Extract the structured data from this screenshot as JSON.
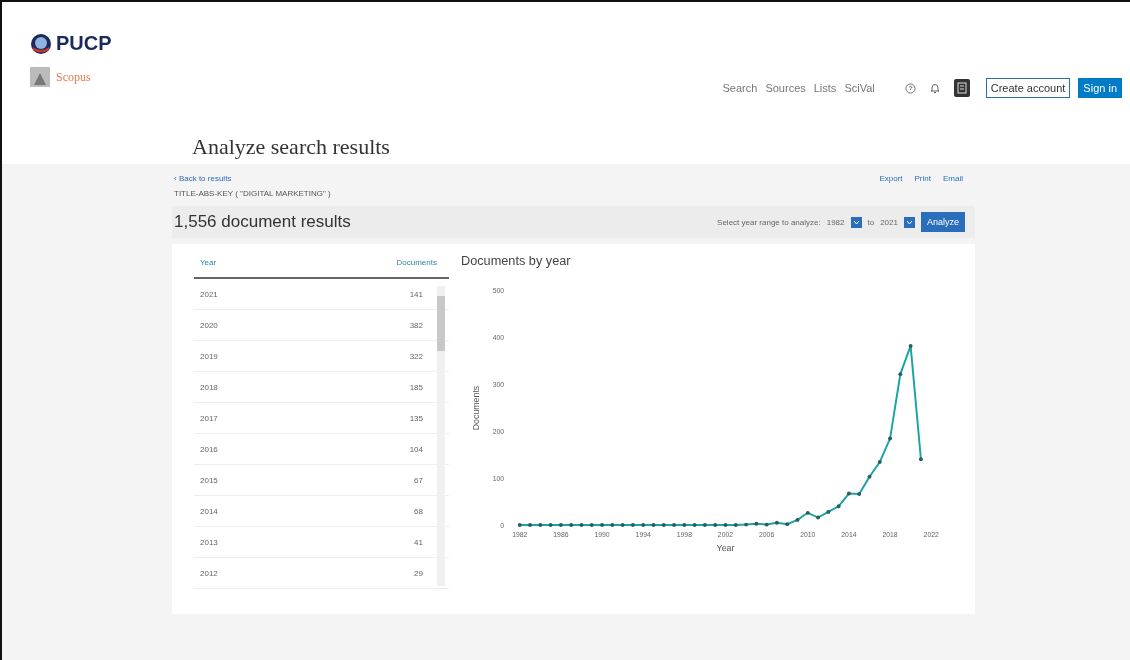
{
  "header": {
    "institution": "PUCP",
    "product": "Scopus",
    "nav": [
      "Search",
      "Sources",
      "Lists",
      "SciVal"
    ],
    "create_account": "Create account",
    "sign_in": "Sign in"
  },
  "page_title": "Analyze search results",
  "back_link": "‹ Back to results",
  "query": "TITLE-ABS-KEY ( \"DIGITAL MARKETING\" )",
  "actions": [
    "Export",
    "Print",
    "Email"
  ],
  "results_count": "1,556 document results",
  "range": {
    "label": "Select year range to analyze:",
    "from": "1982",
    "to_label": "to",
    "to": "2021",
    "button": "Analyze"
  },
  "table": {
    "columns": [
      "Year",
      "Documents"
    ],
    "rows": [
      {
        "year": "2021",
        "documents": "141"
      },
      {
        "year": "2020",
        "documents": "382"
      },
      {
        "year": "2019",
        "documents": "322"
      },
      {
        "year": "2018",
        "documents": "185"
      },
      {
        "year": "2017",
        "documents": "135"
      },
      {
        "year": "2016",
        "documents": "104"
      },
      {
        "year": "2015",
        "documents": "67"
      },
      {
        "year": "2014",
        "documents": "68"
      },
      {
        "year": "2013",
        "documents": "41"
      },
      {
        "year": "2012",
        "documents": "29"
      }
    ]
  },
  "chart": {
    "chart_data": {
      "type": "line",
      "title": "Documents by year",
      "xlabel": "Year",
      "ylabel": "Documents",
      "x": [
        1982,
        1983,
        1984,
        1985,
        1986,
        1987,
        1988,
        1989,
        1990,
        1991,
        1992,
        1993,
        1994,
        1995,
        1996,
        1997,
        1998,
        1999,
        2000,
        2001,
        2002,
        2003,
        2004,
        2005,
        2006,
        2007,
        2008,
        2009,
        2010,
        2011,
        2012,
        2013,
        2014,
        2015,
        2016,
        2017,
        2018,
        2019,
        2020,
        2021
      ],
      "series": [
        {
          "color": "#1aa3a3",
          "values": [
            1,
            1,
            1,
            1,
            1,
            1,
            1,
            1,
            1,
            1,
            1,
            1,
            1,
            1,
            1,
            1,
            1,
            1,
            1,
            1,
            1,
            1,
            2,
            4,
            2,
            6,
            3,
            12,
            27,
            17,
            29,
            41,
            68,
            67,
            104,
            135,
            185,
            322,
            382,
            141
          ]
        }
      ],
      "xlim": [
        1982,
        2022
      ],
      "ylim": [
        0,
        500
      ],
      "xticks": [
        1982,
        1986,
        1990,
        1994,
        1998,
        2002,
        2006,
        2010,
        2014,
        2018,
        2022
      ],
      "yticks": [
        0,
        100,
        200,
        300,
        400,
        500
      ]
    }
  }
}
